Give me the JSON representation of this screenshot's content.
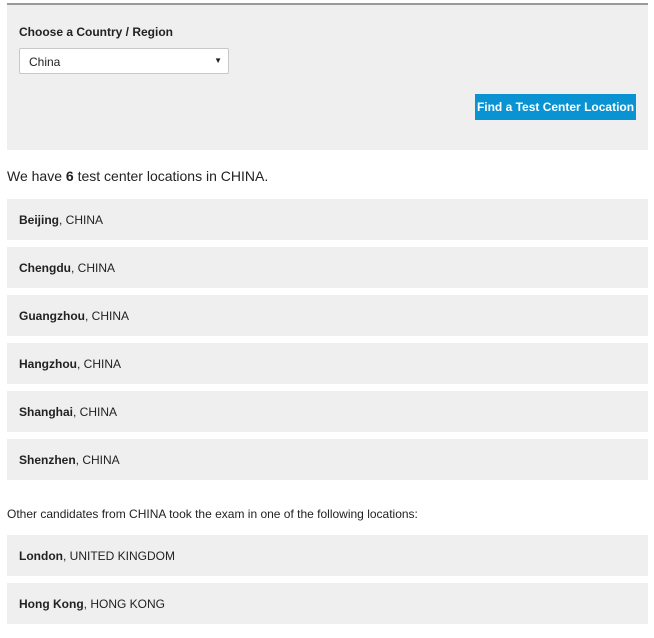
{
  "search": {
    "label": "Choose a Country / Region",
    "selected_country": "China",
    "dropdown_arrow": "▼",
    "button_label": "Find a Test Center Location"
  },
  "results": {
    "prefix": "We have ",
    "count": "6",
    "suffix": " test center locations in CHINA."
  },
  "locations": [
    {
      "city": "Beijing",
      "country": ", CHINA"
    },
    {
      "city": "Chengdu",
      "country": ", CHINA"
    },
    {
      "city": "Guangzhou",
      "country": ", CHINA"
    },
    {
      "city": "Hangzhou",
      "country": ", CHINA"
    },
    {
      "city": "Shanghai",
      "country": ", CHINA"
    },
    {
      "city": "Shenzhen",
      "country": ", CHINA"
    }
  ],
  "other": {
    "note": "Other candidates from CHINA took the exam in one of the following locations:",
    "locations": [
      {
        "city": "London",
        "country": ", UNITED KINGDOM"
      },
      {
        "city": "Hong Kong",
        "country": ", HONG KONG"
      }
    ]
  },
  "colors": {
    "panel_bg": "#f0eff0",
    "button_bg": "#0a93d2",
    "button_text": "#ffffff",
    "text": "#222222"
  }
}
